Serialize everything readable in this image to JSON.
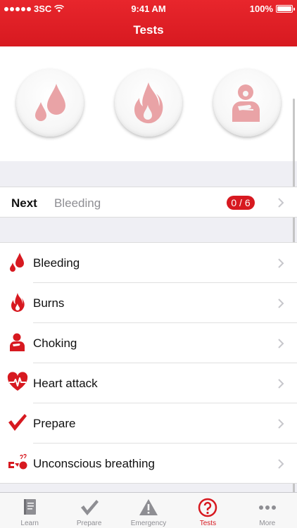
{
  "status_bar": {
    "carrier": "3SC",
    "time": "9:41 AM",
    "battery": "100%"
  },
  "nav": {
    "title": "Tests"
  },
  "hero": {
    "icons": [
      "blood-drop-icon",
      "flame-icon",
      "choking-person-icon"
    ]
  },
  "next": {
    "label": "Next",
    "topic": "Bleeding",
    "progress": "0 / 6"
  },
  "tests": [
    {
      "label": "Bleeding",
      "icon": "blood-drop-icon"
    },
    {
      "label": "Burns",
      "icon": "flame-icon"
    },
    {
      "label": "Choking",
      "icon": "choking-person-icon"
    },
    {
      "label": "Heart attack",
      "icon": "heart-ecg-icon"
    },
    {
      "label": "Prepare",
      "icon": "checkmark-icon"
    },
    {
      "label": "Unconscious breathing",
      "icon": "recovery-position-icon"
    }
  ],
  "tabs": [
    {
      "label": "Learn",
      "icon": "book-icon",
      "active": false
    },
    {
      "label": "Prepare",
      "icon": "checkmark-icon",
      "active": false
    },
    {
      "label": "Emergency",
      "icon": "warning-icon",
      "active": false
    },
    {
      "label": "Tests",
      "icon": "question-circle-icon",
      "active": true
    },
    {
      "label": "More",
      "icon": "ellipsis-icon",
      "active": false
    }
  ],
  "colors": {
    "brand_red": "#d71920",
    "pale_red": "#e9a3a6",
    "inactive_gray": "#8e8e93"
  }
}
